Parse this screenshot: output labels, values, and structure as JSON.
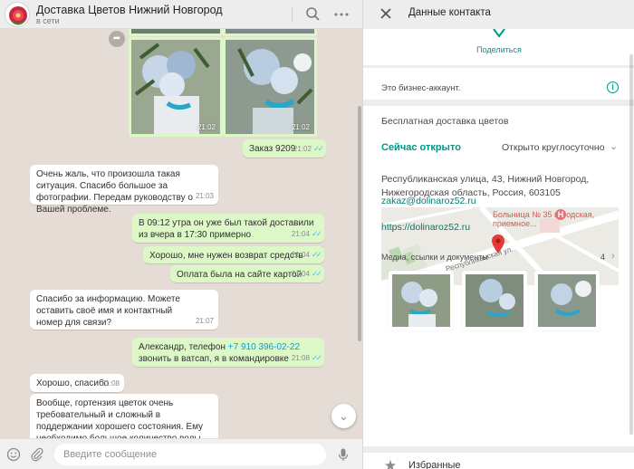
{
  "chat": {
    "header": {
      "title": "Доставка Цветов Нижний Новгород",
      "status": "в сети",
      "icons": [
        "avatar-logo",
        "search-icon",
        "menu-dots-icon"
      ]
    },
    "photos": [
      {
        "time": "21:02"
      },
      {
        "time": "21:02"
      }
    ],
    "messages": [
      {
        "direction": "out",
        "text": "Заказ 9209",
        "time": "21:02"
      },
      {
        "direction": "in",
        "text": "Очень жаль, что произошла такая ситуация. Спасибо большое за фотографии. Передам руководству о Вашей проблеме.",
        "time": "21:03"
      },
      {
        "direction": "out",
        "text": "В 09:12 утра он уже был такой доставили из вчера в 17:30 примерно",
        "time": "21:04"
      },
      {
        "direction": "out",
        "text": "Хорошо, мне нужен возврат средств",
        "time": "21:04"
      },
      {
        "direction": "out",
        "text": "Оплата была на сайте картой",
        "time": "21:04"
      },
      {
        "direction": "in",
        "text": "Спасибо за информацию. Можете оставить своё имя и контактный номер для связи?",
        "time": "21:07"
      },
      {
        "direction": "out",
        "text_before": "Александр, телефон ",
        "phone": "+7 910 396-02-22",
        "text_after": " звонить в ватсап, я в командировке",
        "time": "21:08"
      },
      {
        "direction": "in",
        "text": "Хорошо, спасибо",
        "time": "21:08"
      },
      {
        "direction": "in",
        "text": "Вообще, гортензия цветок очень требовательный и сложный в поддержании хорошего состояния. Ему необходимо большое количество воды. Можно"
      }
    ],
    "composer": {
      "placeholder": "Введите сообщение",
      "icons": [
        "emoji-icon",
        "attach-icon",
        "mic-icon"
      ]
    }
  },
  "contact": {
    "title": "Данные контакта",
    "share_label": "Поделиться",
    "business_note": "Это бизнес-аккаунт.",
    "about": "Бесплатная доставка цветов",
    "open_status": "Сейчас открыто",
    "open_hours": "Открыто круглосуточно",
    "address": "Республиканская улица, 43, Нижний Новгород, Нижегородская область, Россия, 603105",
    "map": {
      "poi_label": "Больница № 35 городская, приемное...",
      "street_label": "Республиканская ул."
    },
    "email": "zakaz@dolinaroz52.ru",
    "website": "https://dolinaroz52.ru",
    "media": {
      "label": "Медиа, ссылки и документы",
      "count": "4"
    },
    "bottom_label": "Избранные"
  },
  "colors": {
    "accent": "#009688",
    "outgoing_bubble": "#dcf8c6",
    "chat_background": "#e5ddd5",
    "read_tick": "#4fc3f7"
  }
}
